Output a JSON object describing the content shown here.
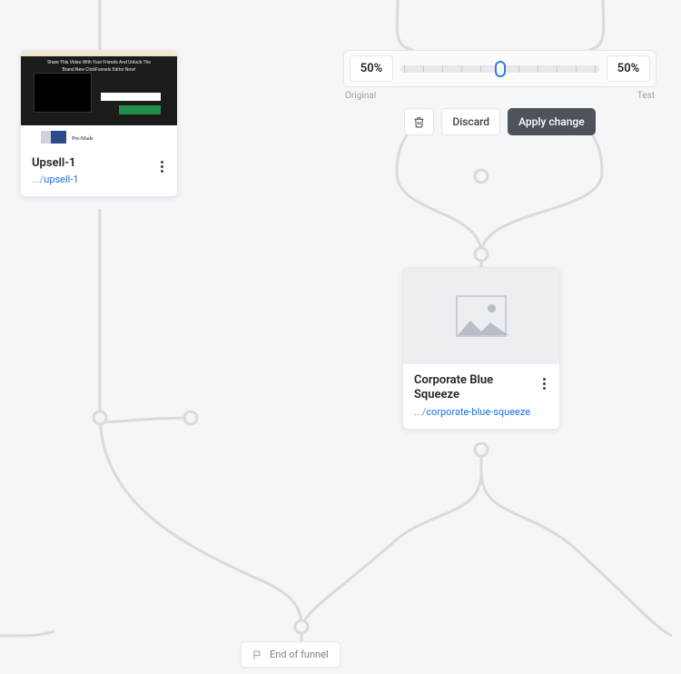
{
  "split": {
    "left_pct": "50%",
    "right_pct": "50%",
    "left_label": "Original",
    "right_label": "Test",
    "discard_label": "Discard",
    "apply_label": "Apply change"
  },
  "cards": {
    "upsell": {
      "title": "Upsell-1",
      "url_prefix": ".../",
      "slug": "upsell-1",
      "thumb_headline1": "Share This Video With Your Friends And Unlock The",
      "thumb_headline2": "Brand New ClickFunnels Editor Now!",
      "thumb_footer": "Pre-Made"
    },
    "corporate": {
      "title": "Corporate Blue Squeeze",
      "url_prefix": ".../",
      "slug": "corporate-blue-squeeze"
    }
  },
  "end_label": "End of funnel"
}
